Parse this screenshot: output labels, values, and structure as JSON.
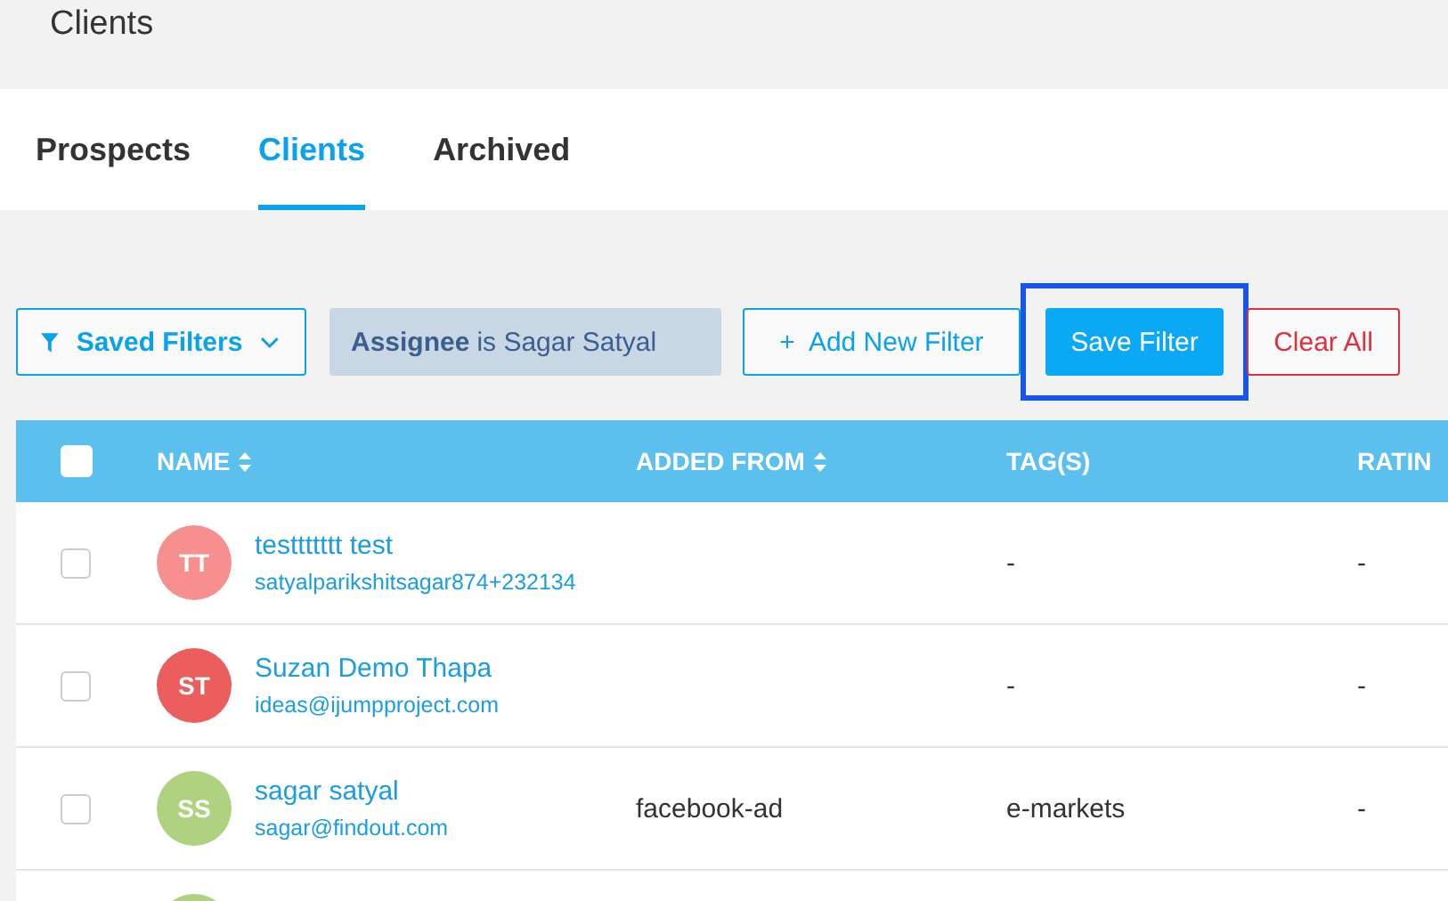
{
  "page_title": "Clients",
  "tabs": [
    {
      "label": "Prospects",
      "selected": false
    },
    {
      "label": "Clients",
      "selected": true
    },
    {
      "label": "Archived",
      "selected": false
    }
  ],
  "filters": {
    "saved_filters": "Saved Filters",
    "active_filter": {
      "field": "Assignee",
      "operator_value": "is Sagar Satyal"
    },
    "add_filter": "+  Add New Filter",
    "save_filter": "Save Filter",
    "save_highlighted": true,
    "clear_all": "Clear All"
  },
  "table": {
    "select_all_checked": false,
    "columns": [
      {
        "label": "NAME",
        "sortable": true
      },
      {
        "label": "ADDED FROM",
        "sortable": true
      },
      {
        "label": "TAG(S)",
        "sortable": false
      },
      {
        "label": "RATIN",
        "sortable": false
      }
    ],
    "rows": [
      {
        "checked": false,
        "initials": "TT",
        "color": "#f78f8f",
        "name": "testtttttt test",
        "email": "satyalparikshitsagar874+232134",
        "tags": "-",
        "rating": "-"
      },
      {
        "checked": false,
        "initials": "ST",
        "color": "#ec5d5d",
        "name": "Suzan Demo Thapa",
        "email": "ideas@ijumpproject.com",
        "tags": "-",
        "rating": "-"
      },
      {
        "checked": false,
        "initials": "SS",
        "color": "#aed27f",
        "name": "sagar satyal",
        "email": "sagar@findout.com",
        "added_from": "facebook-ad",
        "tags": "e-markets",
        "rating": "-"
      },
      {
        "color": "#aed27f"
      }
    ]
  }
}
